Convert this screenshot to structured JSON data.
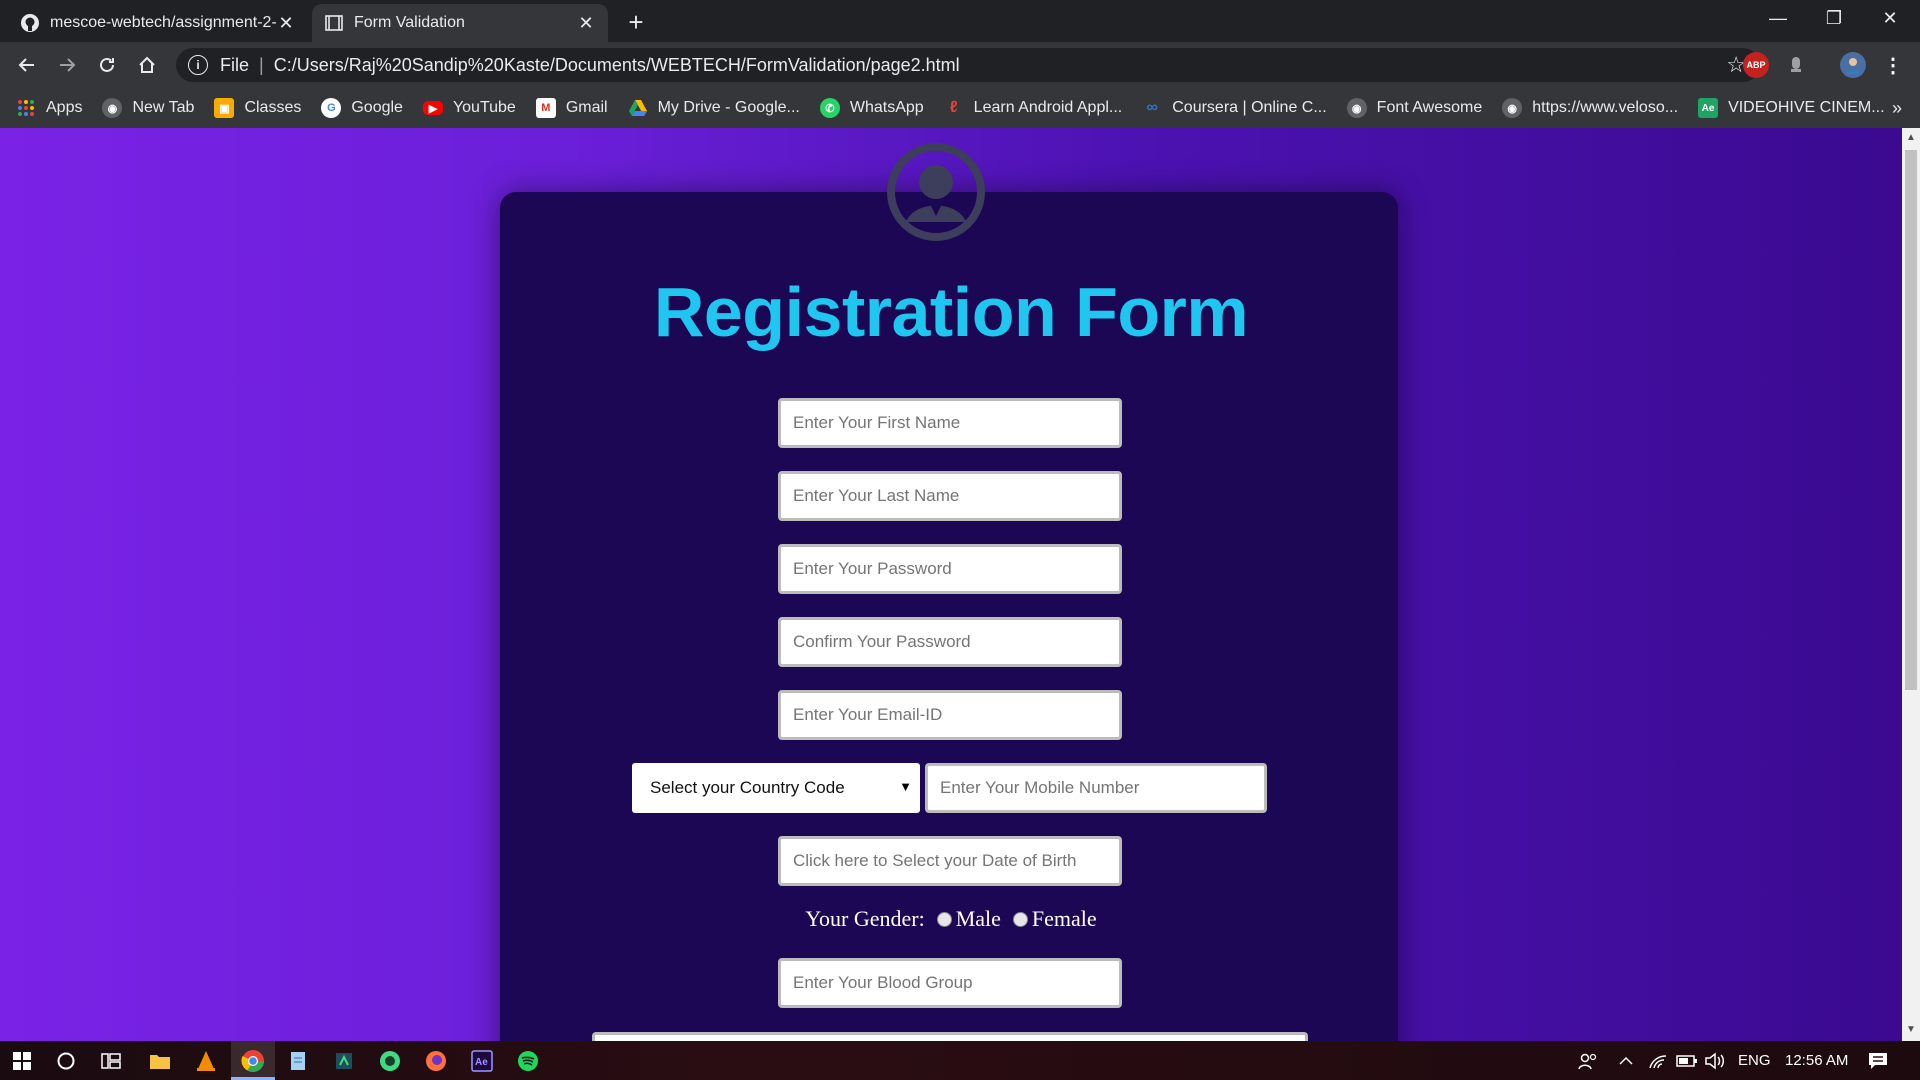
{
  "browser": {
    "tabs": [
      {
        "title": "mescoe-webtech/assignment-2-",
        "favicon": "github-icon",
        "active": false
      },
      {
        "title": "Form Validation",
        "favicon": "page-icon",
        "active": true
      }
    ],
    "address": {
      "scheme_label": "File",
      "url": "C:/Users/Raj%20Sandip%20Kaste/Documents/WEBTECH/FormValidation/page2.html"
    },
    "extensions": {
      "abp_label": "ABP"
    },
    "bookmarks": [
      {
        "label": "Apps",
        "icon": "apps-grid-icon",
        "color": "#e94235"
      },
      {
        "label": "New Tab",
        "icon": "globe-icon",
        "color": "#5f6368"
      },
      {
        "label": "Classes",
        "icon": "classroom-icon",
        "color": "#f9ab00"
      },
      {
        "label": "Google",
        "icon": "google-icon",
        "color": "#4285f4"
      },
      {
        "label": "YouTube",
        "icon": "youtube-icon",
        "color": "#ff0000"
      },
      {
        "label": "Gmail",
        "icon": "gmail-icon",
        "color": "#d93025"
      },
      {
        "label": "My Drive - Google...",
        "icon": "drive-icon",
        "color": "#1fa463"
      },
      {
        "label": "WhatsApp",
        "icon": "whatsapp-icon",
        "color": "#25d366"
      },
      {
        "label": "Learn Android Appl...",
        "icon": "udacity-icon",
        "color": "#e94235"
      },
      {
        "label": "Coursera | Online C...",
        "icon": "coursera-icon",
        "color": "#2a73cc"
      },
      {
        "label": "Font Awesome",
        "icon": "globe-icon",
        "color": "#5f6368"
      },
      {
        "label": "https://www.veloso...",
        "icon": "globe-icon",
        "color": "#5f6368"
      },
      {
        "label": "VIDEOHIVE CINEM...",
        "icon": "envato-icon",
        "color": "#1fa463"
      }
    ],
    "bookmarks_more": "»"
  },
  "form": {
    "title": "Registration Form",
    "first_name_placeholder": "Enter Your First Name",
    "last_name_placeholder": "Enter Your Last Name",
    "password_placeholder": "Enter Your Password",
    "confirm_password_placeholder": "Confirm Your Password",
    "email_placeholder": "Enter Your Email-ID",
    "country_code_selected": "Select your Country Code",
    "mobile_placeholder": "Enter Your Mobile Number",
    "dob_placeholder": "Click here to Select your Date of Birth",
    "gender_label": "Your Gender:",
    "gender_male": "Male",
    "gender_female": "Female",
    "blood_group_placeholder": "Enter Your Blood Group"
  },
  "taskbar": {
    "language": "ENG",
    "time": "12:56 AM"
  },
  "colors": {
    "title_cyan": "#1fc6f0",
    "card_bg": "#1c0754",
    "page_purple": "#7a22e6"
  }
}
